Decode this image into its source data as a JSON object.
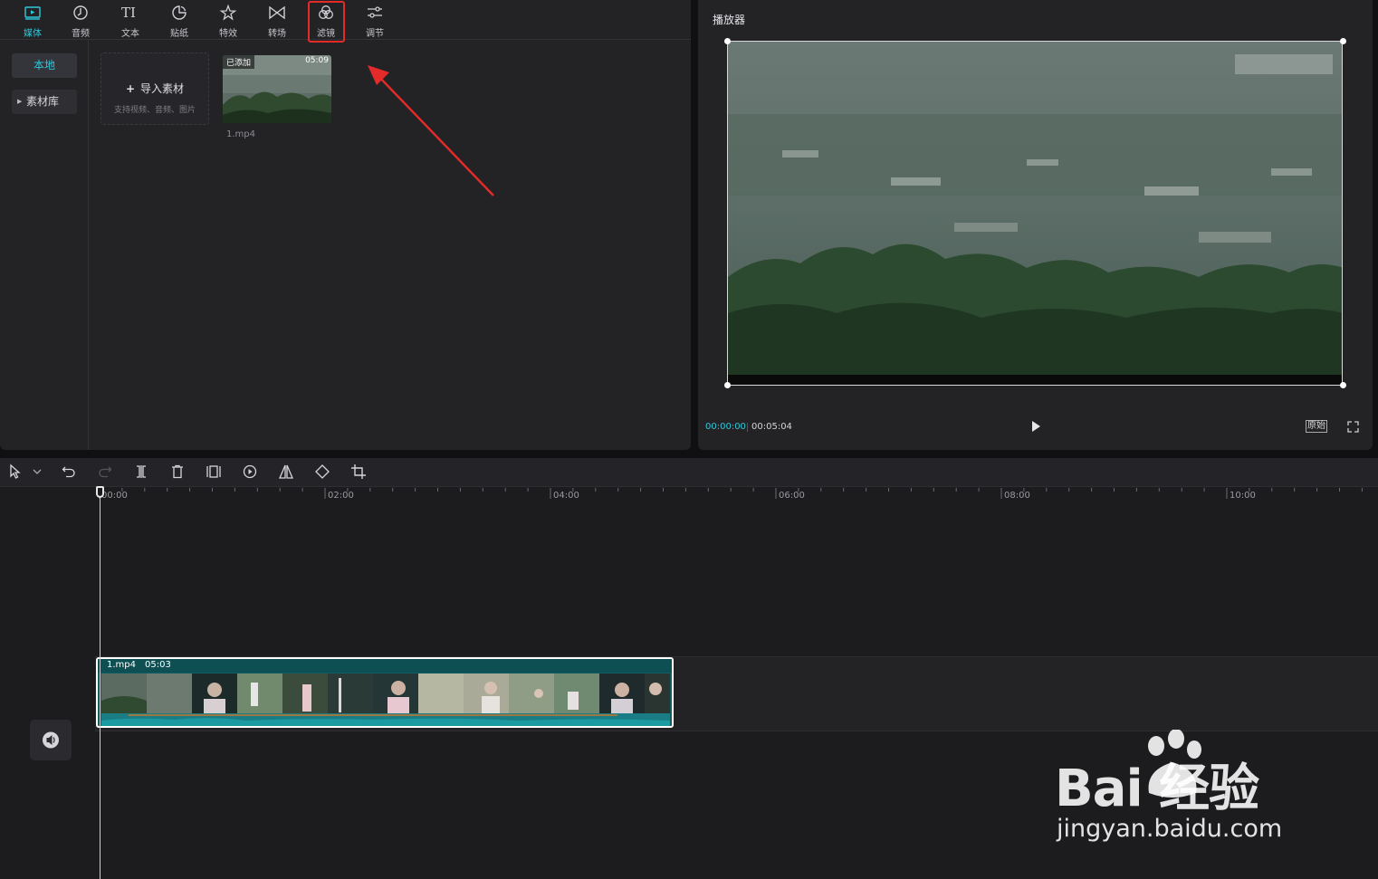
{
  "toolbar": {
    "tabs": [
      {
        "label": "媒体",
        "icon": "media-icon",
        "active": true
      },
      {
        "label": "音频",
        "icon": "audio-icon"
      },
      {
        "label": "文本",
        "icon": "text-icon"
      },
      {
        "label": "贴纸",
        "icon": "sticker-icon"
      },
      {
        "label": "特效",
        "icon": "effects-icon"
      },
      {
        "label": "转场",
        "icon": "transition-icon"
      },
      {
        "label": "滤镜",
        "icon": "filter-icon",
        "highlighted": true
      },
      {
        "label": "调节",
        "icon": "adjust-icon"
      }
    ]
  },
  "sidebar": {
    "local": "本地",
    "library": "素材库"
  },
  "import": {
    "title": "导入素材",
    "subtitle": "支持视频、音频、图片"
  },
  "media_item": {
    "badge": "已添加",
    "duration": "05:09",
    "name": "1.mp4"
  },
  "player": {
    "title": "播放器",
    "current_time": "00:00:00",
    "total_time": "00:05:04",
    "ratio_label": "原始"
  },
  "timeline": {
    "ruler": [
      "00:00",
      "02:00",
      "04:00",
      "06:00",
      "08:00",
      "10:00"
    ],
    "clip": {
      "name": "1.mp4",
      "duration": "05:03"
    }
  },
  "watermark": {
    "logo_text": "Bai 经验",
    "url": "jingyan.baidu.com"
  },
  "colors": {
    "accent": "#2fc7db",
    "highlight_box": "#e52a2a",
    "arrow": "#e52a2a",
    "clip_bg": "#0f5e63"
  }
}
